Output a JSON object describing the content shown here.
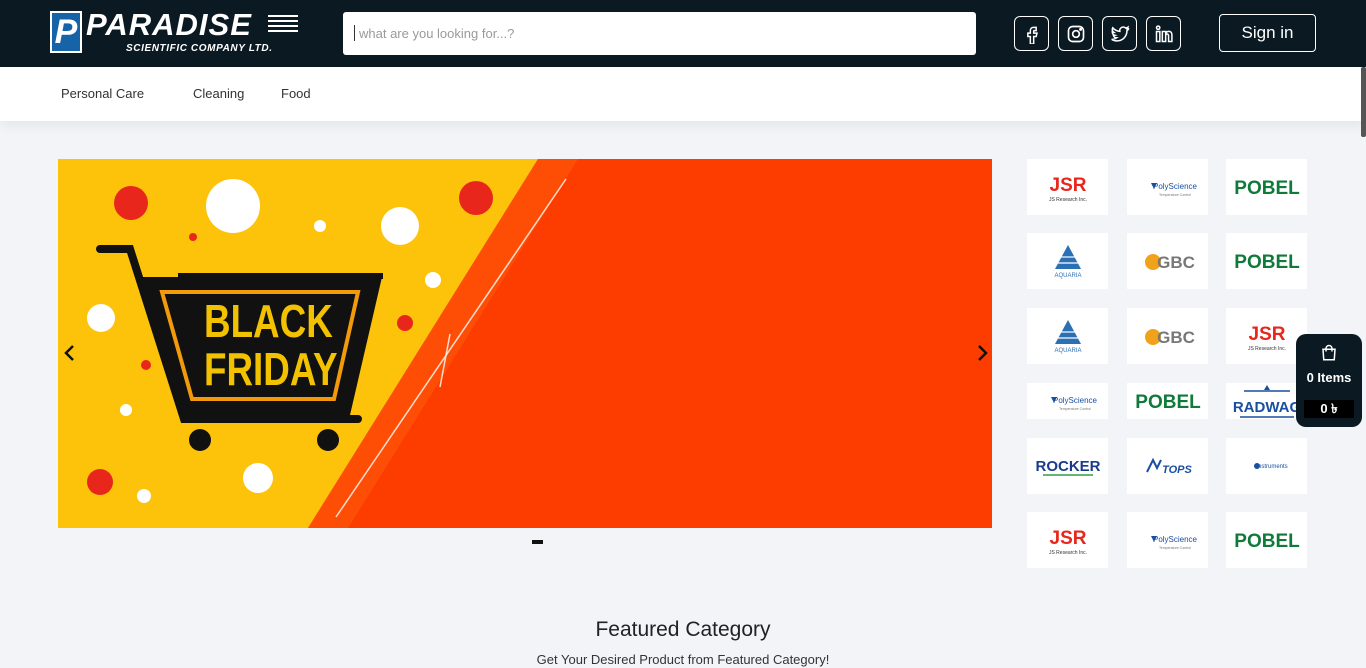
{
  "brand": {
    "name": "PARADISE",
    "subtitle": "SCIENTIFIC COMPANY LTD.",
    "letter": "P"
  },
  "search": {
    "placeholder": "what are you looking for...?",
    "value": ""
  },
  "social": [
    {
      "name": "facebook-icon"
    },
    {
      "name": "instagram-icon"
    },
    {
      "name": "twitter-icon"
    },
    {
      "name": "linkedin-icon"
    }
  ],
  "header": {
    "signin_label": "Sign in"
  },
  "categories": [
    "Personal Care",
    "Cleaning",
    "Food"
  ],
  "banner": {
    "line1": "BLACK",
    "line2": "FRIDAY"
  },
  "brands": [
    [
      "JSR",
      "PolyScience",
      "POBEL"
    ],
    [
      "AQUARIA",
      "GBC",
      "POBEL"
    ],
    [
      "AQUARIA",
      "GBC",
      "JSR"
    ],
    [
      "PolyScience",
      "POBEL",
      "RADWAG"
    ],
    [
      "ROCKER",
      "TOPS",
      "Instruments"
    ],
    [
      "JSR",
      "PolyScience",
      "POBEL"
    ]
  ],
  "cart": {
    "items_label": "0 Items",
    "total_label": "0 ৳"
  },
  "featured": {
    "title": "Featured Category",
    "subtitle": "Get Your Desired Product from Featured Category!"
  },
  "colors": {
    "header_bg": "#0b1a22",
    "banner_yellow": "#fdc20a",
    "banner_orange": "#fd3d00",
    "accent_red": "#e8261b"
  }
}
